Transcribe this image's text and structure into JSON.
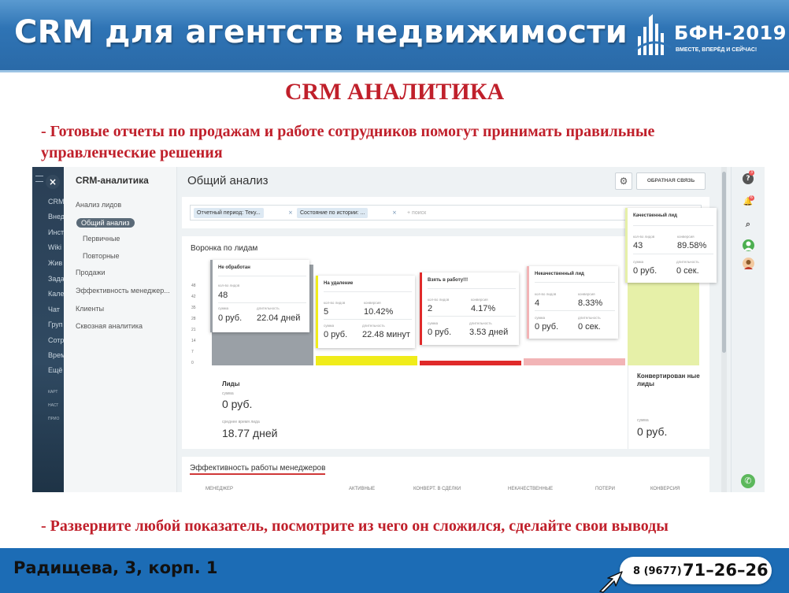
{
  "header": {
    "title": "CRM для агентств недвижимости",
    "logo_text": "БФН-2019",
    "logo_tagline": "ВМЕСТЕ, ВПЕРЁД И СЕЙЧАС!"
  },
  "slide_title": "CRM АНАЛИТИКА",
  "bullets": {
    "first": "- Готовые отчеты по продажам и работе сотрудников помогут принимать правильные управленческие решения",
    "second": "- Разверните любой показатель, посмотрите из чего он сложился, сделайте свои выводы"
  },
  "footer": {
    "address": "Радищева, 3, корп. 1",
    "phone_code": "8 (9677)",
    "phone_number": "71–26–26"
  },
  "app": {
    "left_nav": {
      "close_icon": "×",
      "items": [
        "CRM",
        "Внед",
        "Инст",
        "Wiki",
        "Жив",
        "Зада",
        "Кале",
        "Чат",
        "Груп",
        "Сотр",
        "Врем",
        "Ещё"
      ],
      "small_items": [
        "КАРТ",
        "НАСТ",
        "ПРИО"
      ]
    },
    "sidebar": {
      "title": "CRM-аналитика",
      "items": {
        "lead_analysis": "Анализ лидов",
        "general": "Общий анализ",
        "primary": "Первичные",
        "repeat": "Повторные",
        "sales": "Продажи",
        "manager_eff": "Эффективность менеджер...",
        "clients": "Клиенты",
        "through": "Сквозная аналитика"
      }
    },
    "page_title": "Общий анализ",
    "gear_icon": "⚙",
    "feedback_button": "ОБРАТНАЯ СВЯЗЬ",
    "filter": {
      "chip1": "Отчетный период: Теку...",
      "chip2": "Состояние по истории: ...",
      "chip_close": "×",
      "search_placeholder": "+ поиск"
    },
    "funnel": {
      "title": "Воронка по лидам",
      "y_ticks": [
        "48",
        "42",
        "35",
        "28",
        "21",
        "14",
        "7",
        "0"
      ],
      "stages": {
        "not_processed": {
          "title": "Не обработан",
          "count_label": "кол-во лидов",
          "count": "48",
          "sum_label": "сумма",
          "sum": "0 руб.",
          "dur_label": "длительность",
          "dur": "22.04 дней"
        },
        "removal": {
          "title": "На удаление",
          "count_label": "кол-во лидов",
          "count": "5",
          "conv_label": "конверсия",
          "conv": "10.42%",
          "sum_label": "сумма",
          "sum": "0 руб.",
          "dur_label": "длительность",
          "dur": "22.48 минут"
        },
        "taken": {
          "title": "Взять в работу!!!",
          "count_label": "кол-во лидов",
          "count": "2",
          "conv_label": "конверсия",
          "conv": "4.17%",
          "sum_label": "сумма",
          "sum": "0 руб.",
          "dur_label": "длительность",
          "dur": "3.53 дней"
        },
        "bad": {
          "title": "Некачественный лид",
          "count_label": "кол-во лидов",
          "count": "4",
          "conv_label": "конверсия",
          "conv": "8.33%",
          "sum_label": "сумма",
          "sum": "0 руб.",
          "dur_label": "длительность",
          "dur": "0 сек."
        },
        "good": {
          "title": "Качественный лид",
          "count_label": "кол-во лидов",
          "count": "43",
          "conv_label": "конверсия",
          "conv": "89.58%",
          "sum_label": "сумма",
          "sum": "0 руб.",
          "dur_label": "длительность",
          "dur": "0 сек."
        }
      },
      "leads": {
        "label": "Лиды",
        "sum_label": "сумма",
        "sum": "0 руб.",
        "time_label": "среднее время лида",
        "time": "18.77 дней"
      },
      "converted": {
        "label": "Конвертирован ные лиды",
        "sum_label": "сумма",
        "sum": "0 руб."
      }
    },
    "managers": {
      "title": "Эффективность работы менеджеров",
      "columns": [
        "МЕНЕДЖЕР",
        "АКТИВНЫЕ",
        "КОНВЕРТ. В СДЕЛКИ",
        "НЕКАЧЕСТВЕННЫЕ",
        "ПОТЕРИ",
        "КОНВЕРСИЯ"
      ]
    },
    "right_bar": {
      "help_icon": "?",
      "bell_icon": "🔔",
      "search_icon": "⌕",
      "phone_icon": "✆",
      "help_badge": "3",
      "bell_badge": "6"
    }
  },
  "colors": {
    "header_blue": "#2f74b5",
    "accent_red": "#c0202b",
    "stage_gray": "#9aa0a6",
    "stage_yellow": "#f0ec1a",
    "stage_red": "#e02a2a",
    "stage_pink": "#f2b4b6",
    "stage_green": "#e6f0a8"
  }
}
